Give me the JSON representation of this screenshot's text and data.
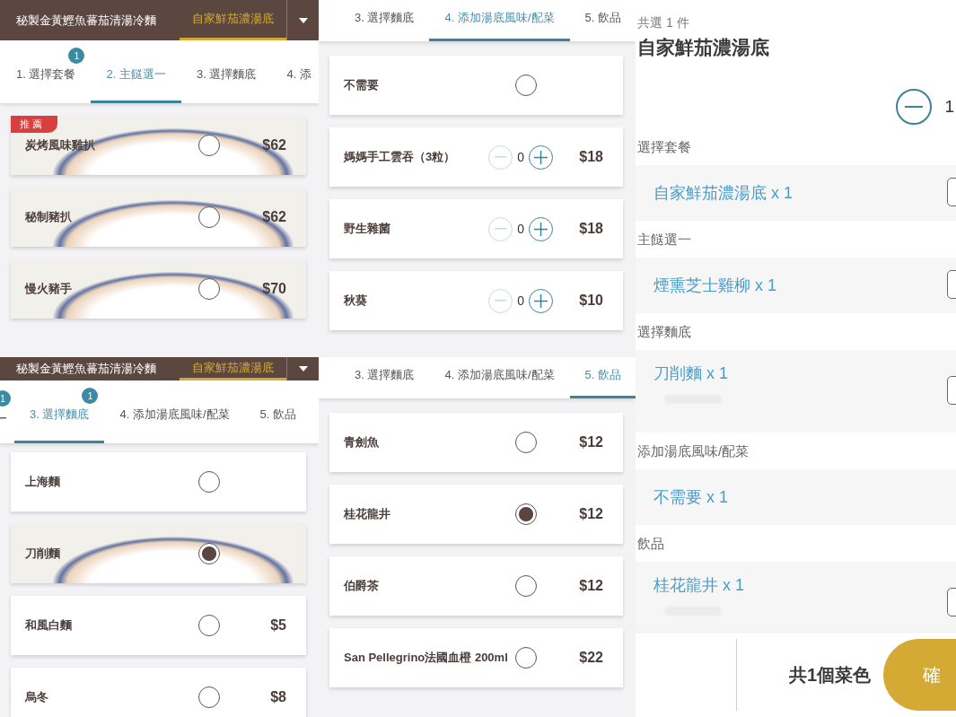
{
  "panels": [
    {
      "kind": "menu",
      "header": {
        "title": "秘製金黃鰹魚蕃茄清湯冷麵",
        "variant": "自家鮮茄濃湯底",
        "variant_selected": true
      },
      "steps": [
        {
          "label": "1. 選擇套餐",
          "badge": "1",
          "selected": false
        },
        {
          "label": "2. 主餸選一",
          "selected": true
        },
        {
          "label": "3. 選擇麵底",
          "selected": false
        },
        {
          "label": "4. 添",
          "selected": false
        }
      ],
      "options": [
        {
          "kind": "radio",
          "name": "炭烤風味雞扒",
          "selected": false,
          "price": "$62",
          "tag": "推薦",
          "photo": true
        },
        {
          "kind": "radio",
          "name": "秘制豬扒",
          "selected": false,
          "price": "$62",
          "photo": true
        },
        {
          "kind": "radio",
          "name": "慢火豬手",
          "selected": false,
          "price": "$70",
          "photo": true
        }
      ]
    },
    {
      "kind": "menu",
      "steps": [
        {
          "label": "3. 選擇麵底",
          "selected": false
        },
        {
          "label": "4. 添加湯底風味/配菜",
          "selected": true
        },
        {
          "label": "5. 飲品",
          "selected": false
        }
      ],
      "options": [
        {
          "kind": "radio",
          "name": "不需要",
          "selected": false,
          "photo": false
        },
        {
          "kind": "counter",
          "name": "媽媽手工雲吞（3粒）",
          "quantity": "0",
          "price": "$18"
        },
        {
          "kind": "counter",
          "name": "野生雜菌",
          "quantity": "0",
          "price": "$18"
        },
        {
          "kind": "counter",
          "name": "秋葵",
          "quantity": "0",
          "price": "$10"
        }
      ]
    },
    {
      "kind": "summary",
      "count_label": "共選 1 件",
      "title": "自家鮮茄濃湯底",
      "quantity": "1",
      "sections": [
        {
          "label": "選擇套餐",
          "item": "自家鮮茄濃湯底 x 1",
          "note_button": true,
          "blurred_note": false
        },
        {
          "label": "主餸選一",
          "item": "煙熏芝士雞柳 x 1",
          "note_button": true,
          "blurred_note": false
        },
        {
          "label": "選擇麵底",
          "item": "刀削麵 x 1",
          "note_button": true,
          "blurred_note": true
        },
        {
          "label": "添加湯底風味/配菜",
          "item": "不需要 x 1",
          "note_button": false,
          "blurred_note": false
        },
        {
          "label": "飲品",
          "item": "桂花龍井 x 1",
          "note_button": true,
          "blurred_note": true
        }
      ],
      "footer": {
        "total": "共1個菜色",
        "confirm": "確"
      }
    },
    {
      "kind": "menu",
      "header": {
        "title": "秘製金黃鰹魚蕃茄清湯冷麵",
        "variant": "自家鮮茄濃湯底",
        "variant_selected": true
      },
      "steps": [
        {
          "badge": "1",
          "selected": false
        },
        {
          "label": "3. 選擇麵底",
          "badge": "1",
          "selected": true
        },
        {
          "label": "4. 添加湯底風味/配菜",
          "selected": false
        },
        {
          "label": "5. 飲品",
          "selected": false
        }
      ],
      "options": [
        {
          "kind": "radio",
          "name": "上海麵",
          "selected": false,
          "photo": false
        },
        {
          "kind": "radio",
          "name": "刀削麵",
          "selected": true,
          "photo": true
        },
        {
          "kind": "radio",
          "name": "和風白麵",
          "selected": false,
          "price": "$5",
          "photo": false
        },
        {
          "kind": "radio",
          "name": "烏冬",
          "selected": false,
          "price": "$8",
          "photo": false
        }
      ]
    },
    {
      "kind": "menu",
      "steps": [
        {
          "label": "3. 選擇麵底",
          "selected": false
        },
        {
          "label": "4. 添加湯底風味/配菜",
          "selected": false
        },
        {
          "label": "5. 飲品",
          "selected": true
        }
      ],
      "options": [
        {
          "kind": "radio",
          "name": "青劍魚",
          "selected": false,
          "price": "$12",
          "photo": false
        },
        {
          "kind": "radio",
          "name": "桂花龍井",
          "selected": true,
          "price": "$12",
          "photo": false
        },
        {
          "kind": "radio",
          "name": "伯爵茶",
          "selected": false,
          "price": "$12",
          "photo": false
        },
        {
          "kind": "radio",
          "name": "San Pellegrino法國血橙 200ml",
          "selected": false,
          "price": "$22",
          "photo": false
        }
      ]
    }
  ]
}
